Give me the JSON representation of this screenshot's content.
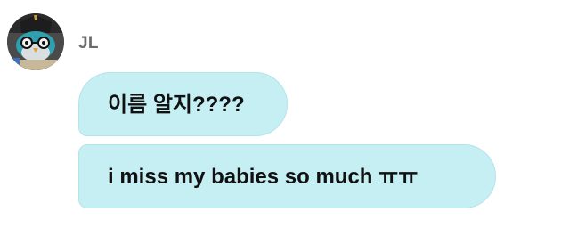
{
  "sender": {
    "avatar_icon": "cartoon-bird-avatar-icon",
    "name": "JL"
  },
  "messages": [
    {
      "text": "이름 알지????"
    },
    {
      "text": "i miss my babies so much ㅠㅠ"
    }
  ],
  "colors": {
    "bubble_background": "#c6eff4",
    "bubble_border": "#b4e4ea",
    "name_text": "#6b6b6b",
    "message_text": "#111111"
  }
}
